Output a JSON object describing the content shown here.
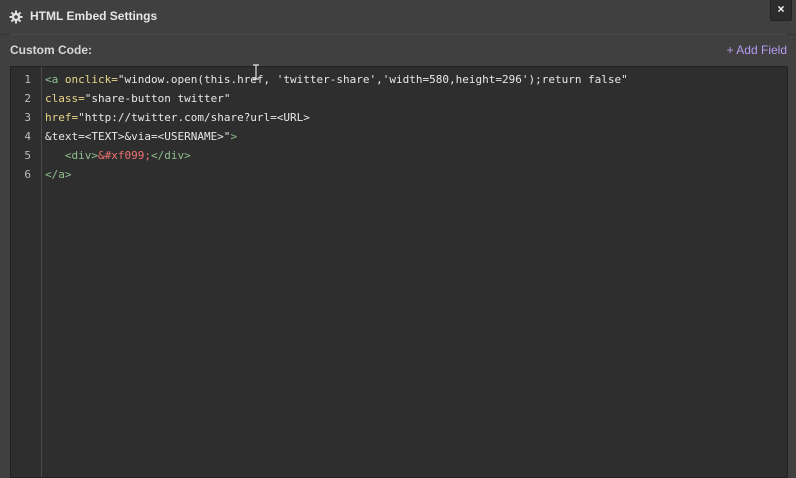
{
  "dialog": {
    "title": "HTML Embed Settings",
    "close_label": "×",
    "icon": "gear-icon"
  },
  "section": {
    "label": "Custom Code:",
    "add_field_label": "+ Add Field"
  },
  "editor": {
    "line_numbers": [
      "1",
      "2",
      "3",
      "4",
      "5",
      "6"
    ],
    "lines": [
      [
        {
          "t": "tag",
          "v": "<a "
        },
        {
          "t": "attr",
          "v": "onclick="
        },
        {
          "t": "str",
          "v": "\"window.open(this.href, 'twitter-share','width=580,height=296');return false\""
        }
      ],
      [
        {
          "t": "attr",
          "v": "class="
        },
        {
          "t": "str",
          "v": "\"share-button twitter\""
        }
      ],
      [
        {
          "t": "attr",
          "v": "href="
        },
        {
          "t": "str",
          "v": "\"http://twitter.com/share?url=<URL>"
        }
      ],
      [
        {
          "t": "str",
          "v": "&text=<TEXT>&via=<USERNAME>\""
        },
        {
          "t": "tag",
          "v": ">"
        }
      ],
      [
        {
          "t": "str",
          "v": "   "
        },
        {
          "t": "tag",
          "v": "<div>"
        },
        {
          "t": "ent",
          "v": "&#xf099;"
        },
        {
          "t": "tag",
          "v": "</div>"
        }
      ],
      [
        {
          "t": "tag",
          "v": "</a>"
        }
      ]
    ]
  },
  "colors": {
    "background": "#404040",
    "editor_bg": "#2e2e2e",
    "accent_link": "#b59af0",
    "tag": "#8fbf8f",
    "attribute": "#e8d58a",
    "entity": "#f07070"
  }
}
